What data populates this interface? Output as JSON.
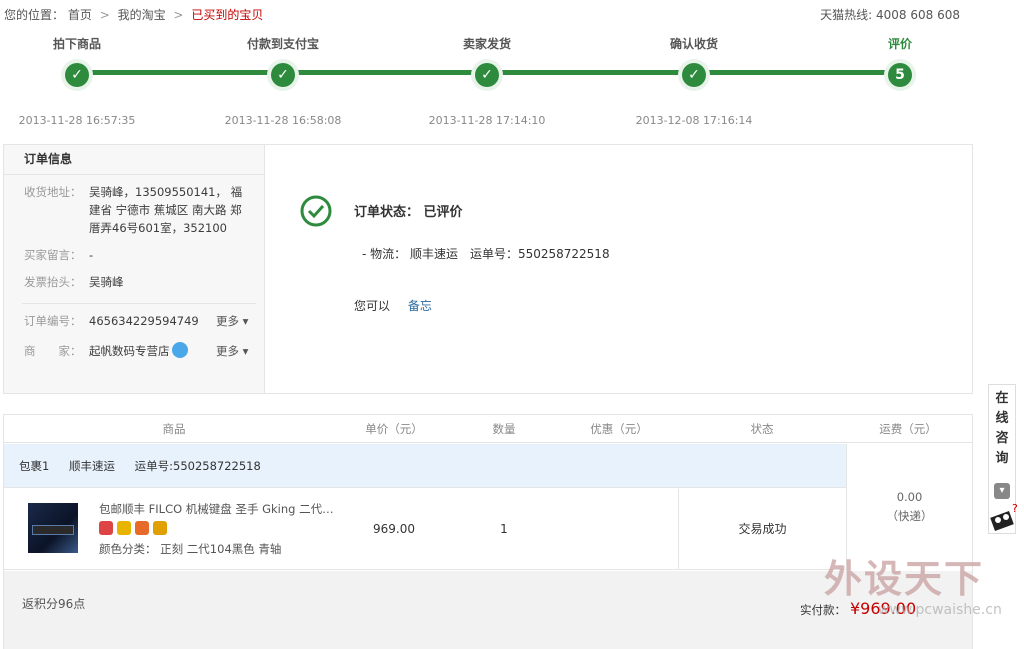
{
  "breadcrumb": {
    "prefix": "您的位置：",
    "items": [
      "首页",
      "我的淘宝"
    ],
    "current": "已买到的宝贝",
    "separator": ">"
  },
  "hotline": "天猫热线: 4008 608 608",
  "progress": {
    "steps": [
      {
        "label": "拍下商品",
        "time": "2013-11-28 16:57:35",
        "node": "✓"
      },
      {
        "label": "付款到支付宝",
        "time": "2013-11-28 16:58:08",
        "node": "✓"
      },
      {
        "label": "卖家发货",
        "time": "2013-11-28 17:14:10",
        "node": "✓"
      },
      {
        "label": "确认收货",
        "time": "2013-12-08 17:16:14",
        "node": "✓"
      },
      {
        "label": "评价",
        "time": "",
        "node": "5"
      }
    ],
    "accent": "#2e8b3d"
  },
  "order_info": {
    "title": "订单信息",
    "address_label": "收货地址：",
    "address_value": "吴骑峰，13509550141， 福建省 宁德市 蕉城区 南大路 郑厝弄46号601室，352100",
    "message_label": "买家留言：",
    "message_value": "-",
    "invoice_label": "发票抬头：",
    "invoice_value": "吴骑峰",
    "order_no_label": "订单编号：",
    "order_no_value": "465634229594749",
    "merchant_label": "商　　家：",
    "merchant_value": "起帆数码专营店",
    "more_label": "更多"
  },
  "order_status": {
    "status_text": "订单状态： 已评价",
    "logistics_text": "- 物流： 顺丰速运　运单号：550258722518",
    "you_can": "您可以",
    "memo_link": "备忘"
  },
  "table": {
    "headers": {
      "product": "商品",
      "unit_price": "单价（元）",
      "quantity": "数量",
      "discount": "优惠（元）",
      "status": "状态",
      "freight": "运费（元）"
    },
    "package": {
      "label": "包裹1",
      "carrier": "顺丰速运",
      "tracking": "运单号:550258722518"
    },
    "item": {
      "name": "包邮顺丰 FILCO 机械键盘 圣手 Gking 二代…",
      "sku": "颜色分类： 正刻 二代104黑色 青轴",
      "price": "969.00",
      "qty": "1",
      "status": "交易成功"
    },
    "freight": {
      "amount": "0.00",
      "type": "（快递）"
    },
    "points": "返积分96点",
    "total_label": "实付款：",
    "total_value": "¥969.00"
  },
  "consult": {
    "text": [
      "在",
      "线",
      "咨",
      "询"
    ]
  },
  "watermark": {
    "big": "外设天下",
    "url": "www.pcwaishe.cn"
  }
}
